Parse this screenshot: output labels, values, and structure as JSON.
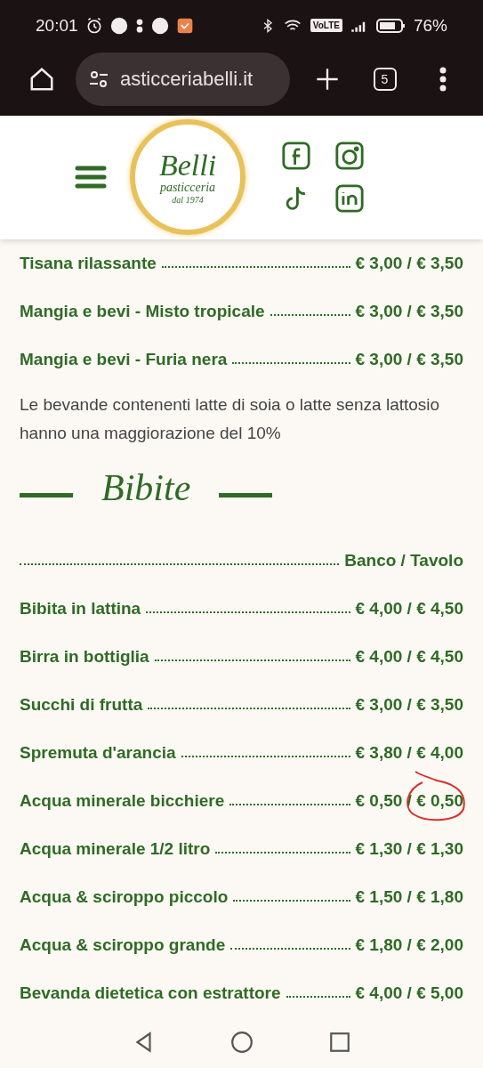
{
  "status_bar": {
    "time": "20:01",
    "battery": "76%",
    "network_badge": "VoLTE"
  },
  "browser": {
    "url": "asticceriabelli.it",
    "tab_count": "5"
  },
  "header": {
    "logo": {
      "name": "Belli",
      "tagline": "pasticceria",
      "since": "dal 1974"
    }
  },
  "menu_top": [
    {
      "name": "Tisana rilassante",
      "price": "€ 3,00 / € 3,50",
      "circled": false
    },
    {
      "name": "Mangia e bevi - Misto tropicale",
      "price": "€ 3,00 / € 3,50",
      "circled": false
    },
    {
      "name": "Mangia e bevi - Furia nera",
      "price": "€ 3,00 / € 3,50",
      "circled": false
    }
  ],
  "note": "Le bevande contenenti latte di soia o latte senza lattosio hanno una maggiorazione del 10%",
  "section": {
    "title": "Bibite",
    "column_header": "Banco / Tavolo",
    "items": [
      {
        "name": "Bibita in lattina",
        "price": "€ 4,00 / € 4,50",
        "circled": false
      },
      {
        "name": "Birra in bottiglia",
        "price": "€ 4,00 / € 4,50",
        "circled": false
      },
      {
        "name": "Succhi di frutta",
        "price": "€ 3,00 / € 3,50",
        "circled": false
      },
      {
        "name": "Spremuta d'arancia",
        "price": "€ 3,80 / € 4,00",
        "circled": false
      },
      {
        "name": "Acqua minerale bicchiere",
        "price": "€ 0,50 / € 0,50",
        "circled": true
      },
      {
        "name": "Acqua minerale 1/2 litro",
        "price": "€ 1,30 / € 1,30",
        "circled": false
      },
      {
        "name": "Acqua & sciroppo piccolo",
        "price": "€ 1,50 / € 1,80",
        "circled": false
      },
      {
        "name": "Acqua & sciroppo grande",
        "price": "€ 1,80 / € 2,00",
        "circled": false
      },
      {
        "name": "Bevanda dietetica con estrattore",
        "price": "€ 4,00 / € 5,00",
        "circled": false
      }
    ]
  }
}
